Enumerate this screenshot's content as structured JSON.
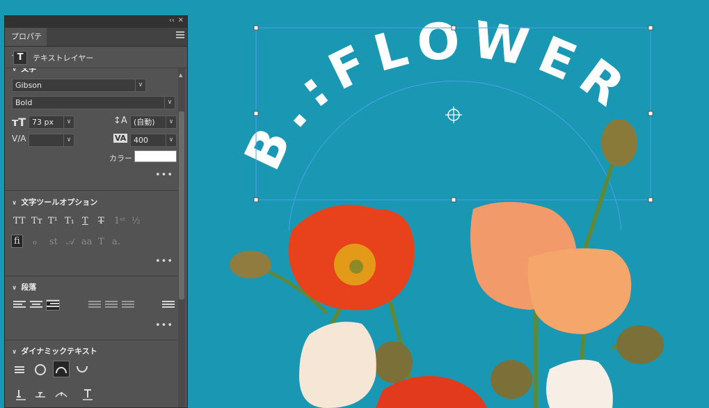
{
  "panel": {
    "tab_label": "プロパティ",
    "layer_type_label": "テキストレイヤー",
    "sections": {
      "character": {
        "header": "文字",
        "font_family": "Gibson",
        "font_style": "Bold",
        "font_size": "73 px",
        "leading": "(自動)",
        "tracking": "400",
        "color_label": "カラー"
      },
      "text_tool_options": {
        "header": "文字ツールオプション"
      },
      "paragraph": {
        "header": "段落"
      },
      "dynamic_text": {
        "header": "ダイナミックテキスト"
      }
    }
  },
  "canvas": {
    "curved_text": "B.:FLOWER",
    "background_color": "#1a98b3"
  },
  "colors": {
    "annotation_red": "#d8261f",
    "annotation_green": "#2ad02a",
    "text_fill": "#ffffff"
  }
}
